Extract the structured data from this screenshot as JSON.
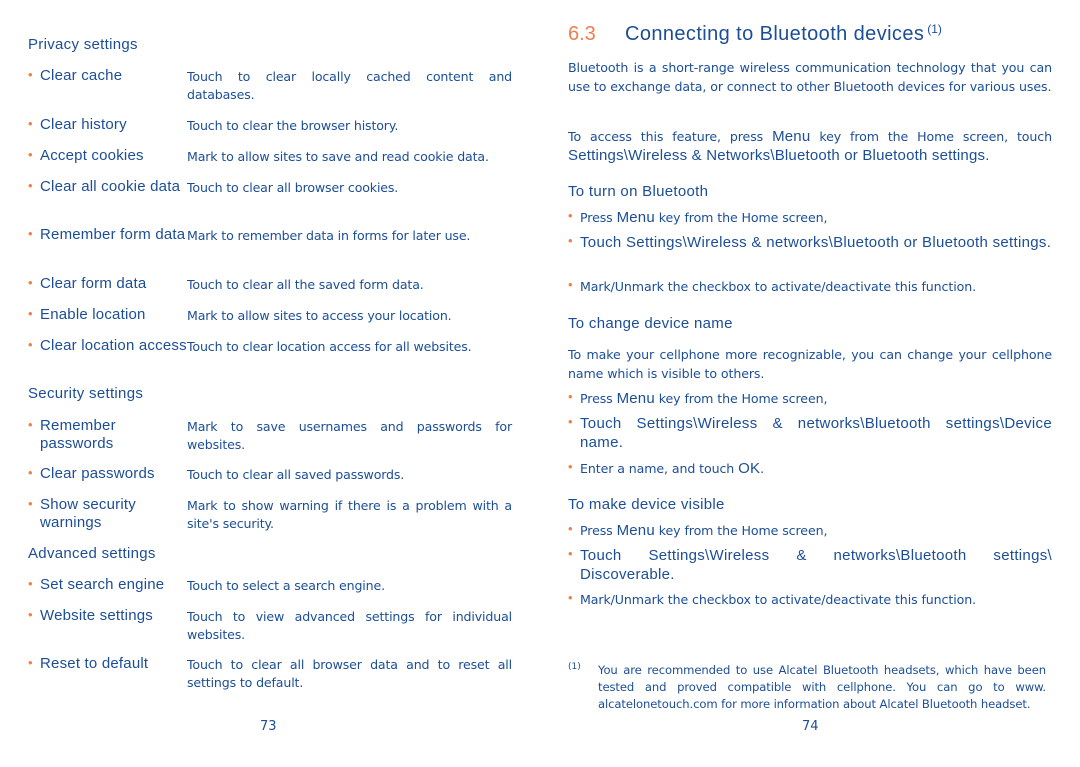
{
  "left_page": {
    "page_number": "73",
    "sections": [
      {
        "heading": "Privacy settings",
        "items": [
          {
            "term": "Clear cache",
            "desc": "Touch to clear locally cached content and databases."
          },
          {
            "term": "Clear history",
            "desc": "Touch to clear the browser history."
          },
          {
            "term": "Accept cookies",
            "desc": "Mark to allow sites to save and read cookie data."
          },
          {
            "term": "Clear all cookie data",
            "desc": "Touch to clear all browser cookies."
          },
          {
            "term": "Remember form data",
            "desc": "Mark to remember data in forms for later use."
          },
          {
            "term": "Clear form data",
            "desc": "Touch to clear all the saved form data."
          },
          {
            "term": "Enable location",
            "desc": "Mark to allow sites to access your location."
          },
          {
            "term": "Clear location access",
            "desc": "Touch to clear location access for all websites."
          }
        ]
      },
      {
        "heading": "Security settings",
        "items": [
          {
            "term": "Remember passwords",
            "desc": "Mark to save usernames and passwords for websites."
          },
          {
            "term": "Clear passwords",
            "desc": "Touch to clear all saved passwords."
          },
          {
            "term": "Show security warnings",
            "desc": "Mark to show warning if there is a problem with a site's security."
          }
        ]
      },
      {
        "heading": "Advanced settings",
        "items": [
          {
            "term": "Set search engine",
            "desc": "Touch to select a search engine."
          },
          {
            "term": "Website settings",
            "desc": "Touch to view advanced settings for individual websites."
          },
          {
            "term": "Reset to default",
            "desc": "Touch to clear all browser data and to reset all settings to default."
          }
        ]
      }
    ]
  },
  "right_page": {
    "page_number": "74",
    "chapter": {
      "number": "6.3",
      "title": "Connecting to Bluetooth devices",
      "footnote_ref": "(1)"
    },
    "intro": "Bluetooth is a short-range wireless communication technology that you can use to exchange data, or connect to other Bluetooth devices for various uses.",
    "access": {
      "pre": "To access this feature, press ",
      "menu": "Menu",
      "mid": " key from the Home screen, touch ",
      "path": "Settings\\Wireless & Networks\\Bluetooth or Bluetooth settings."
    },
    "turn_on": {
      "heading": "To turn on Bluetooth",
      "steps": [
        {
          "pre": "Press ",
          "key": "Menu",
          "post": " key from the Home screen,"
        },
        {
          "text": "Touch Settings\\Wireless & networks\\Bluetooth or Bluetooth settings."
        },
        {
          "text": "Mark/Unmark the checkbox to activate/deactivate this function."
        }
      ]
    },
    "change_name": {
      "heading": "To change device name",
      "intro": "To make your cellphone more recognizable, you can change your cellphone name which is visible to others.",
      "steps": [
        {
          "pre": "Press ",
          "key": "Menu",
          "post": " key from the Home screen,"
        },
        {
          "text": "Touch Settings\\Wireless & networks\\Bluetooth settings\\Device name."
        },
        {
          "pre": "Enter a name, and touch ",
          "key": "OK",
          "post": "."
        }
      ]
    },
    "visible": {
      "heading": "To make device visible",
      "steps": [
        {
          "pre": "Press ",
          "key": "Menu",
          "post": " key from the Home screen,"
        },
        {
          "text": "Touch Settings\\Wireless & networks\\Bluetooth settings\\ Discoverable."
        },
        {
          "text": "Mark/Unmark the checkbox to activate/deactivate this function."
        }
      ]
    },
    "footnote": {
      "mark": "(1)",
      "text": "You are recommended to use Alcatel Bluetooth headsets, which have been tested and proved compatible with cellphone. You can go to www. alcatelonetouch.com for more information about Alcatel Bluetooth headset."
    }
  },
  "colors": {
    "text": "#1c4e96",
    "accent": "#f07f4a",
    "background": "#ffffff"
  }
}
